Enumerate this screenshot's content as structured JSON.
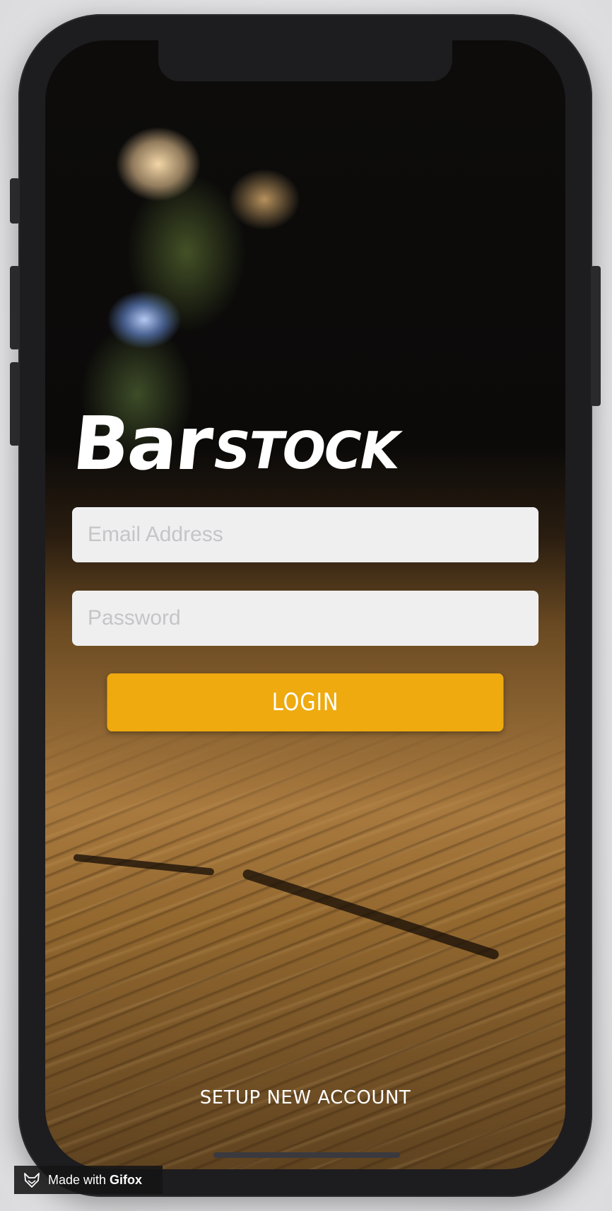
{
  "app": {
    "logo_primary": "Bar",
    "logo_secondary": "STOCK"
  },
  "login_form": {
    "email_placeholder": "Email Address",
    "email_value": "",
    "password_placeholder": "Password",
    "password_value": "",
    "login_label": "LOGIN",
    "setup_label": "SETUP NEW ACCOUNT"
  },
  "watermark": {
    "prefix": "Made with",
    "brand": "Gifox",
    "icon": "fox-icon"
  },
  "colors": {
    "accent": "#eeaa0e",
    "input_bg": "#efeff0",
    "placeholder": "#c5c5c8",
    "phone_body": "#1d1c1f"
  }
}
